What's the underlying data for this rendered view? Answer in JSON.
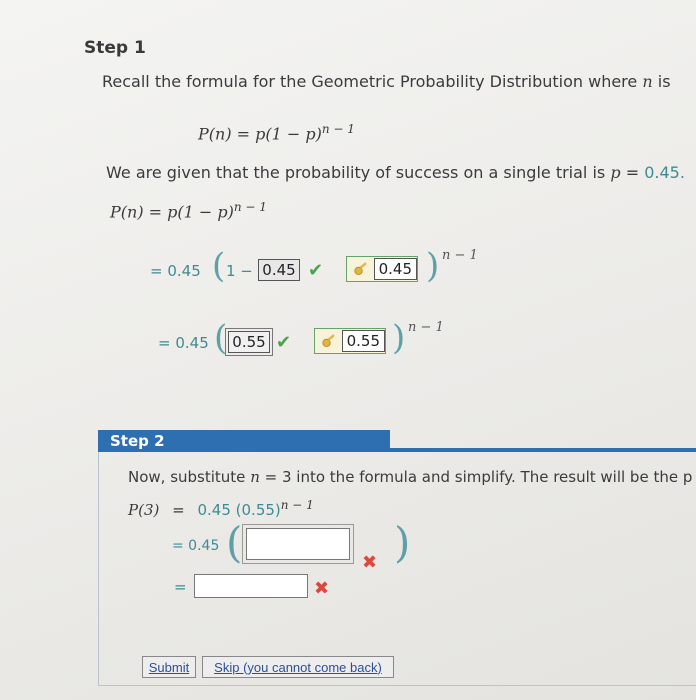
{
  "step1": {
    "title": "Step 1",
    "recall_text": "Recall the formula for the Geometric Probability Distribution where",
    "recall_var": "n",
    "recall_tail": "is",
    "formula_lhs": "P(n) = p(1 − p)",
    "formula_exp": "n − 1",
    "given_text": "We are given that the probability of success on a single trial is",
    "given_var": "p",
    "given_eq": "=",
    "given_val": "0.45.",
    "formula2_lhs": "P(n) = p(1 − p)",
    "formula2_exp": "n − 1",
    "line1": {
      "prefix": "= 0.45",
      "minus": "1 −",
      "answer": "0.45",
      "hint_value": "0.45",
      "exponent": "n − 1"
    },
    "line2": {
      "prefix": "= 0.45",
      "answer": "0.55",
      "hint_value": "0.55",
      "exponent": "n − 1"
    }
  },
  "step2": {
    "title": "Step 2",
    "text_pre": "Now, substitute",
    "text_var": "n",
    "text_eq": "= 3 into the formula and simplify. The result will be the p",
    "p3_lhs": "P(3)",
    "p3_eq": "=",
    "p3_rhs": "0.45 (0.55)",
    "p3_exp": "n − 1",
    "line1_prefix": "= 0.45",
    "line2_prefix": "="
  },
  "buttons": {
    "submit": "Submit",
    "skip": "Skip (you cannot come back)"
  },
  "colors": {
    "teal": "#3f8b94",
    "header_blue": "#2e6fb1",
    "check_green": "#4aa34a",
    "cross_red": "#d9493f"
  }
}
